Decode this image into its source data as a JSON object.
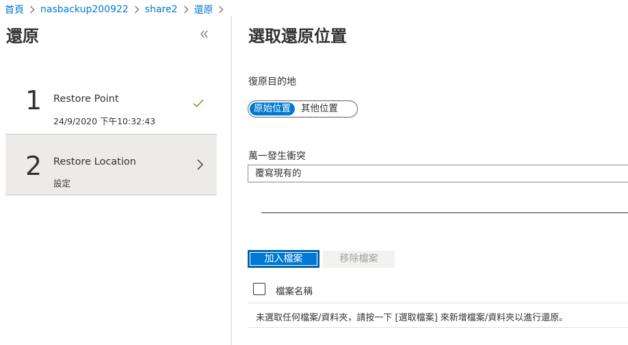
{
  "breadcrumb": {
    "items": [
      {
        "label": "首頁"
      },
      {
        "label": "nasbackup200922"
      },
      {
        "label": "share2"
      },
      {
        "label": "還原"
      }
    ]
  },
  "left_panel": {
    "title": "還原",
    "collapse_icon": "double-chevron-left-icon",
    "steps": [
      {
        "number": "1",
        "title": "Restore Point",
        "subtitle": "24/9/2020 下午10:32:43",
        "status_icon": "checkmark-icon",
        "status_color": "#57a300",
        "selected": false
      },
      {
        "number": "2",
        "title": "Restore Location",
        "subtitle": "設定",
        "status_icon": "chevron-right-icon",
        "selected": true
      }
    ]
  },
  "main": {
    "title": "選取還原位置",
    "destination": {
      "label": "復原目的地",
      "options": [
        "原始位置",
        "其他位置"
      ],
      "selected": "原始位置"
    },
    "conflict": {
      "label": "萬一發生衝突",
      "value": "覆寫現有的"
    },
    "buttons": {
      "add": "加入檔案",
      "remove": "移除檔案"
    },
    "file_grid": {
      "column_header": "檔案名稱",
      "empty_message": "未選取任何檔案/資料夾，請按一下 [選取檔案] 來新增檔案/資料夾以進行還原。"
    }
  },
  "colors": {
    "accent": "#0078d4",
    "selected_step_bg": "#edebe9",
    "disabled_button_bg": "#f3f2f1",
    "disabled_button_text": "#a19f9d"
  }
}
